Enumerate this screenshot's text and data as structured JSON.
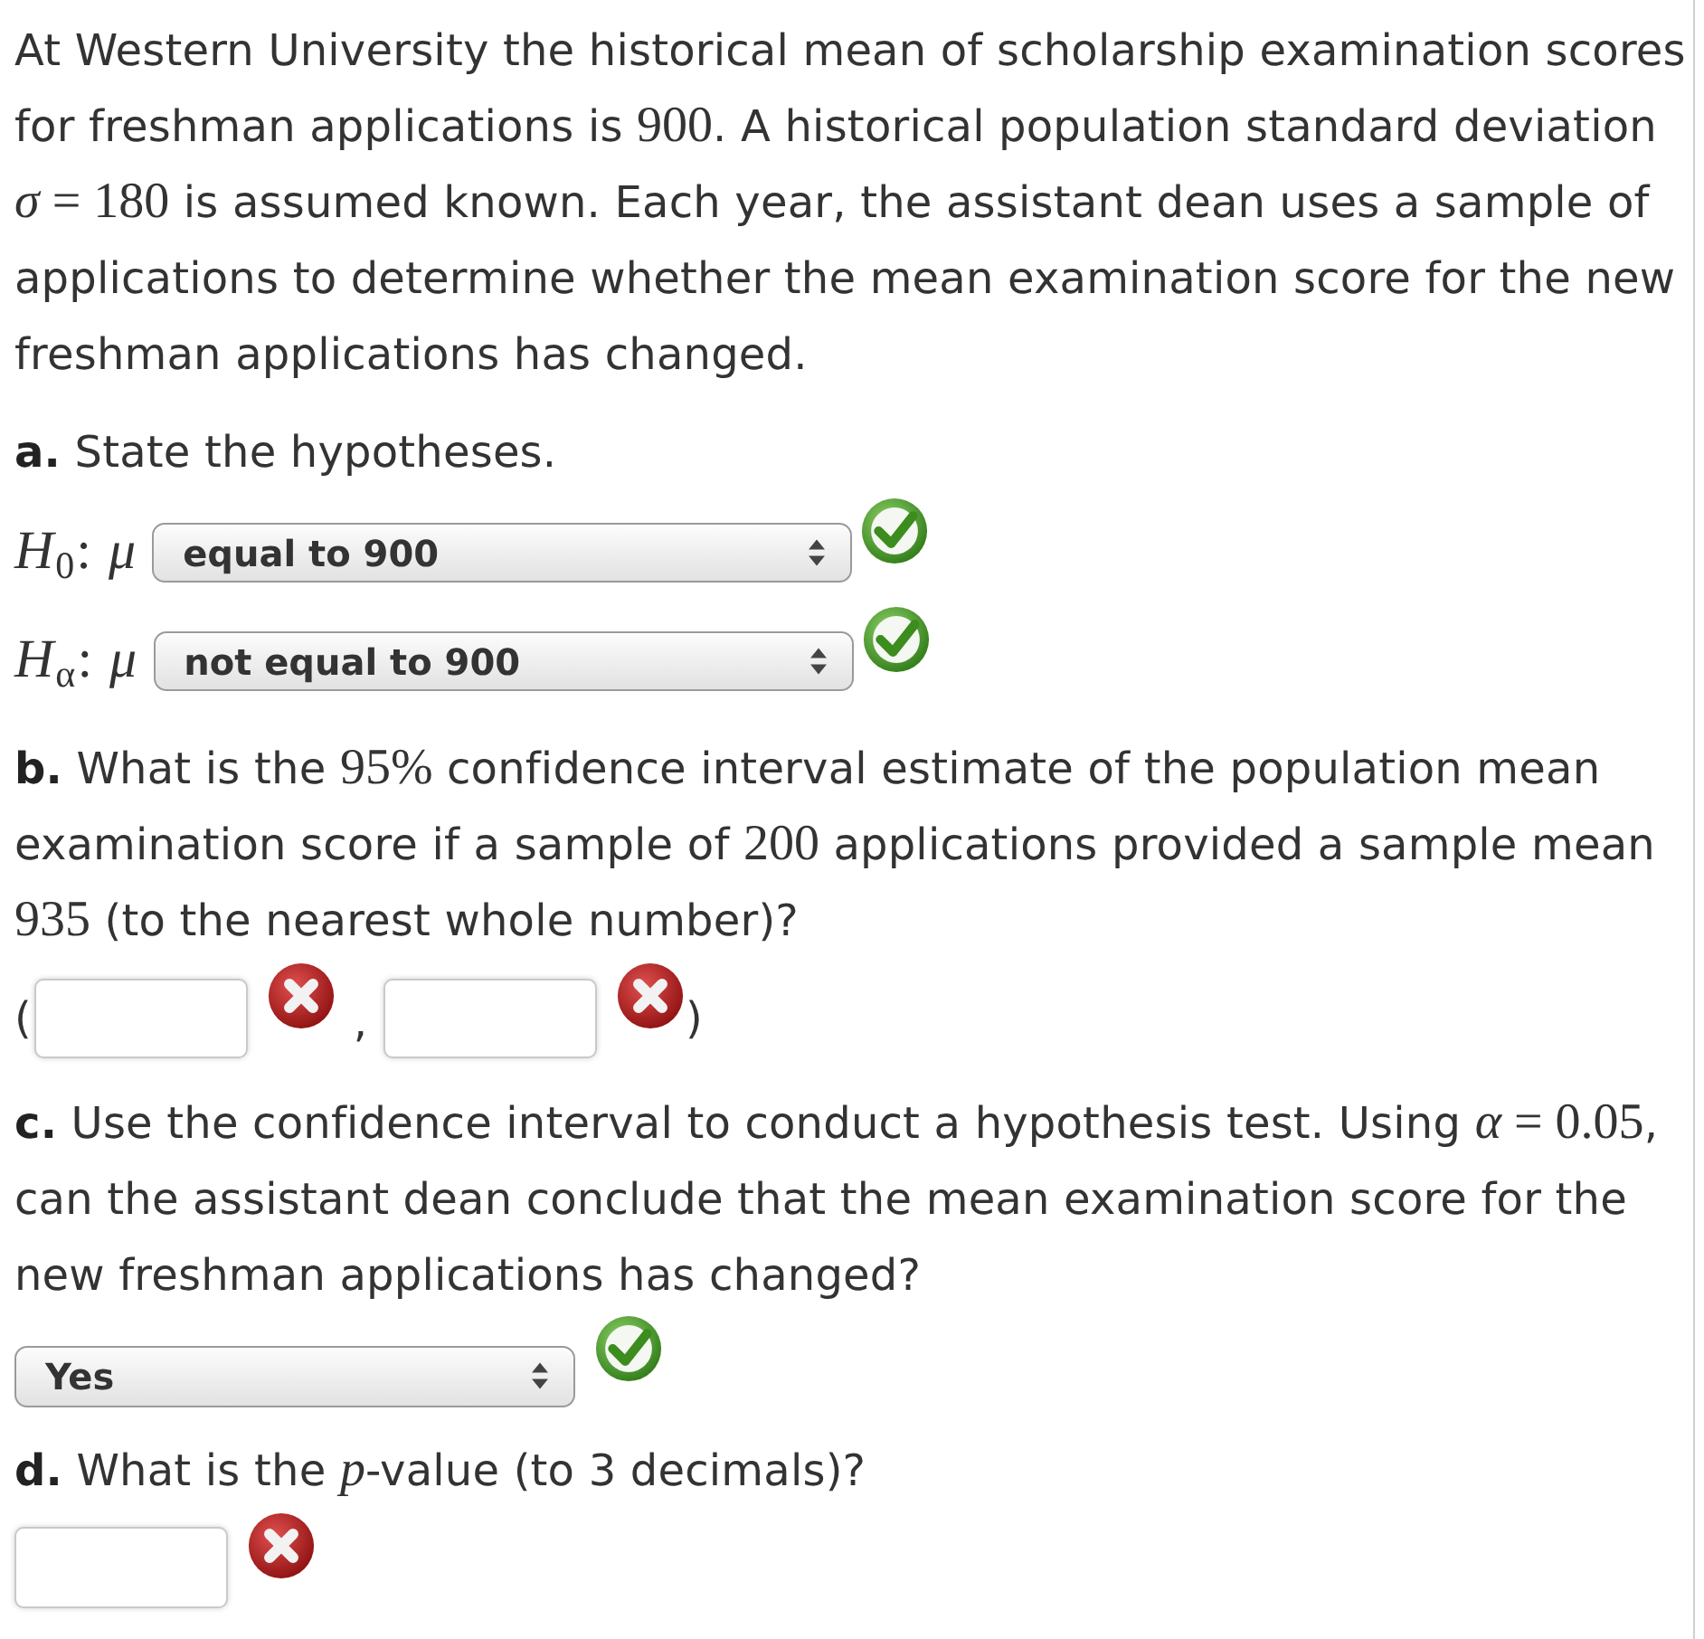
{
  "intro": [
    {
      "kind": "text",
      "text": "At Western University the historical mean of scholarship examination scores for freshman applications is "
    },
    {
      "kind": "math",
      "text": "900"
    },
    {
      "kind": "text",
      "text": ". A historical population standard deviation "
    },
    {
      "kind": "math",
      "text": "*σ* = 180"
    },
    {
      "kind": "text",
      "text": " is assumed known. Each year, the assistant dean uses a sample of applications to determine whether the mean examination score for the new freshman applications has changed."
    }
  ],
  "parts": [
    {
      "kind": "hypotheses",
      "question": [
        {
          "kind": "bold",
          "text": "a."
        },
        {
          "kind": "text",
          "text": " State the hypotheses."
        }
      ],
      "rows": [
        {
          "label": "*H*$_{0}$: *μ*",
          "value": "equal to 900",
          "correct": true
        },
        {
          "label": "*H*$_{α}$: *μ*",
          "value": "not equal to 900",
          "correct": true
        }
      ]
    },
    {
      "kind": "interval",
      "question": [
        {
          "kind": "bold",
          "text": "b."
        },
        {
          "kind": "text",
          "text": " What is the "
        },
        {
          "kind": "math",
          "text": "95%"
        },
        {
          "kind": "text",
          "text": " confidence interval estimate of the population mean examination score if a sample of "
        },
        {
          "kind": "math",
          "text": "200"
        },
        {
          "kind": "text",
          "text": " applications provided a sample mean "
        },
        {
          "kind": "math",
          "text": "935"
        },
        {
          "kind": "text",
          "text": " (to the nearest whole number)?"
        }
      ],
      "open": "(",
      "separator": ",",
      "close": ")",
      "fields": [
        {
          "correct": false
        },
        {
          "correct": false
        }
      ]
    },
    {
      "kind": "choice",
      "question": [
        {
          "kind": "bold",
          "text": "c."
        },
        {
          "kind": "text",
          "text": " Use the confidence interval to conduct a hypothesis test. Using "
        },
        {
          "kind": "math",
          "text": "*α* = 0.05"
        },
        {
          "kind": "text",
          "text": ", can the assistant dean conclude that the mean examination score for the new freshman applications has changed?"
        }
      ],
      "value": "Yes",
      "correct": true
    },
    {
      "kind": "answer",
      "question": [
        {
          "kind": "bold",
          "text": "d."
        },
        {
          "kind": "text",
          "text": " What is the "
        },
        {
          "kind": "math",
          "text": "*p*"
        },
        {
          "kind": "text",
          "text": "-value (to 3 decimals)?"
        }
      ],
      "correct": false
    }
  ]
}
